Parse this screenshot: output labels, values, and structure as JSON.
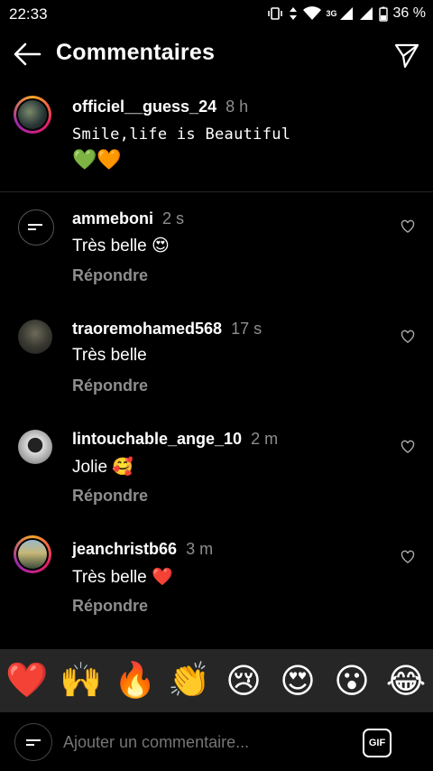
{
  "status": {
    "time": "22:33",
    "battery": "36 %",
    "network": "3G"
  },
  "header": {
    "title": "Commentaires"
  },
  "caption": {
    "username": "officiel__guess_24",
    "time": "8 h",
    "text": "Smile,life is Beautiful",
    "emojis": "💚🧡"
  },
  "comments": [
    {
      "username": "ammeboni",
      "time": "2 s",
      "text": "Très belle 😍",
      "reply": "Répondre"
    },
    {
      "username": "traoremohamed568",
      "time": "17 s",
      "text": "Très belle",
      "reply": "Répondre"
    },
    {
      "username": "lintouchable_ange_10",
      "time": "2 m",
      "text": "Jolie 🥰",
      "reply": "Répondre"
    },
    {
      "username": "jeanchristb66",
      "time": "3 m",
      "text": "Très belle ❤️",
      "reply": "Répondre"
    }
  ],
  "emoji_bar": [
    "❤️",
    "🙌",
    "🔥",
    "👏",
    "😢",
    "😍",
    "😮",
    "😂"
  ],
  "composer": {
    "placeholder": "Ajouter un commentaire...",
    "gif_label": "GIF"
  },
  "colors": {
    "background": "#000000",
    "secondary_text": "#8e8e8e",
    "emoji_bar_bg": "#262626"
  }
}
